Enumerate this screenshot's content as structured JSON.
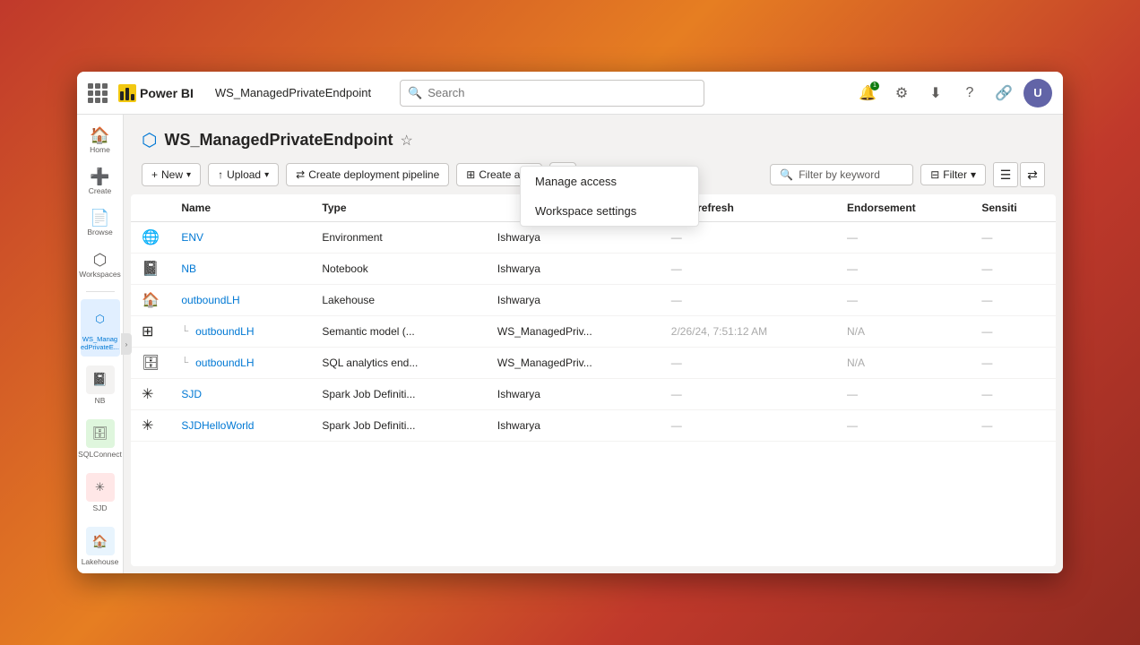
{
  "app": {
    "title": "Power BI",
    "breadcrumb": "WS_ManagedPrivateEndpoint"
  },
  "titlebar": {
    "search_placeholder": "Search",
    "notifications_icon": "🔔",
    "settings_icon": "⚙",
    "download_icon": "⬇",
    "help_icon": "?",
    "share_icon": "🔗",
    "avatar_initials": "U"
  },
  "sidebar": {
    "items": [
      {
        "id": "home",
        "label": "Home",
        "icon": "🏠"
      },
      {
        "id": "create",
        "label": "Create",
        "icon": "➕"
      },
      {
        "id": "browse",
        "label": "Browse",
        "icon": "📄"
      },
      {
        "id": "workspaces",
        "label": "Workspaces",
        "icon": "⬡"
      }
    ],
    "workspace_items": [
      {
        "id": "ws-main",
        "label": "WS_Manag edPrivateE...",
        "icon": "⬡",
        "active": true
      },
      {
        "id": "nb",
        "label": "NB",
        "icon": "📓"
      },
      {
        "id": "sqlconnect",
        "label": "SQLConnect",
        "icon": "🗄"
      },
      {
        "id": "sjd",
        "label": "SJD",
        "icon": "⚙"
      },
      {
        "id": "lakehouse",
        "label": "Lakehouse",
        "icon": "🏠"
      }
    ],
    "more_label": "···"
  },
  "workspace": {
    "icon": "⬡",
    "title": "WS_ManagedPrivateEndpoint",
    "star_icon": "☆"
  },
  "toolbar": {
    "new_label": "New",
    "upload_label": "Upload",
    "create_deployment_pipeline_label": "Create deployment pipeline",
    "create_app_label": "Create app",
    "more_label": "···",
    "filter_placeholder": "Filter by keyword",
    "filter_label": "Filter",
    "list_view_icon": "≡",
    "share_view_icon": "⇄"
  },
  "dropdown": {
    "items": [
      {
        "id": "manage-access",
        "label": "Manage access"
      },
      {
        "id": "workspace-settings",
        "label": "Workspace settings"
      }
    ]
  },
  "table": {
    "columns": [
      "Name",
      "Type",
      "",
      "Next refresh",
      "Endorsement",
      "Sensiti"
    ],
    "rows": [
      {
        "icon": "🌐",
        "name": "ENV",
        "type": "Environment",
        "owner": "Ishwarya",
        "next_refresh": "—",
        "endorsement": "—",
        "sensitivity": "—",
        "indent": false
      },
      {
        "icon": "📓",
        "name": "NB",
        "type": "Notebook",
        "owner": "Ishwarya",
        "next_refresh": "—",
        "endorsement": "—",
        "sensitivity": "—",
        "indent": false
      },
      {
        "icon": "🏠",
        "name": "outboundLH",
        "type": "Lakehouse",
        "owner": "Ishwarya",
        "next_refresh": "—",
        "endorsement": "—",
        "sensitivity": "—",
        "indent": false
      },
      {
        "icon": "⊞",
        "name": "outboundLH",
        "type": "Semantic model (...",
        "owner": "WS_ManagedPriv...",
        "next_refresh": "2/26/24, 7:51:12 AM",
        "endorsement": "N/A",
        "sensitivity": "—",
        "indent": true
      },
      {
        "icon": "🗄",
        "name": "outboundLH",
        "type": "SQL analytics end...",
        "owner": "WS_ManagedPriv...",
        "next_refresh": "—",
        "endorsement": "N/A",
        "sensitivity": "—",
        "indent": true
      },
      {
        "icon": "⚙",
        "name": "SJD",
        "type": "Spark Job Definiti...",
        "owner": "Ishwarya",
        "next_refresh": "—",
        "endorsement": "—",
        "sensitivity": "—",
        "indent": false
      },
      {
        "icon": "⚙",
        "name": "SJDHelloWorld",
        "type": "Spark Job Definiti...",
        "owner": "Ishwarya",
        "next_refresh": "—",
        "endorsement": "—",
        "sensitivity": "—",
        "indent": false
      }
    ]
  }
}
